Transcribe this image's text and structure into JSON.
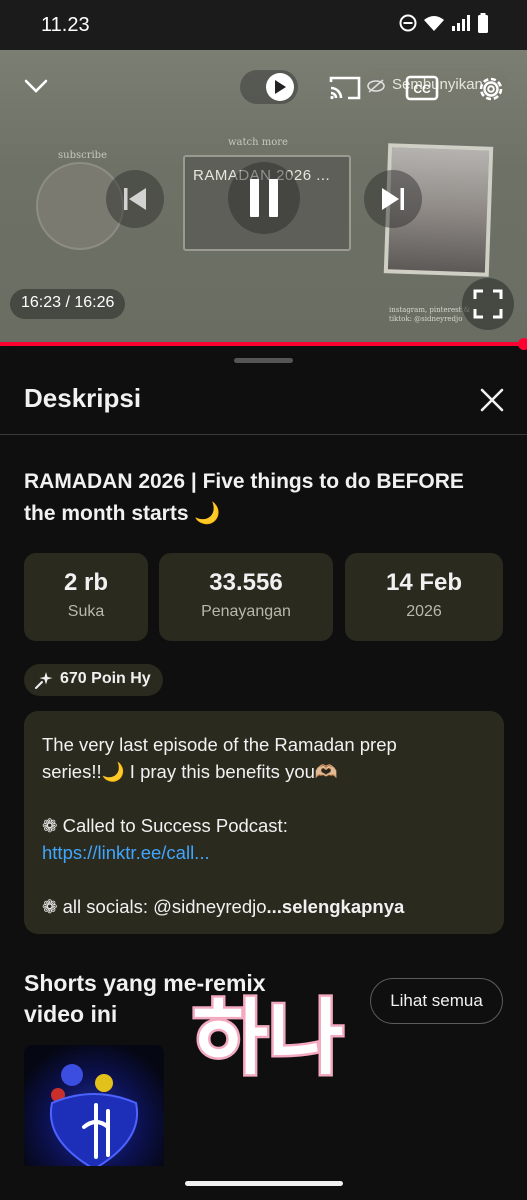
{
  "status_bar": {
    "time": "11.23"
  },
  "player": {
    "thumbnail": {
      "card_title": "RAMADAN 2026 ...",
      "subscribe_text": "subscribe",
      "watch_more_text": "watch more",
      "socials_caption": "instagram, pinterest & tiktok: @sidneyredjo"
    },
    "caption_overlay": "Sembunyikan",
    "time_display": "16:23 / 16:26",
    "progress_fraction": 0.995
  },
  "sheet": {
    "title": "Deskripsi",
    "video_title": "RAMADAN 2026 | Five things to do BEFORE the month starts 🌙",
    "stats": [
      {
        "value": "2 rb",
        "label": "Suka"
      },
      {
        "value": "33.556",
        "label": "Penayangan"
      },
      {
        "value": "14 Feb",
        "label": "2026"
      }
    ],
    "points_chip": "670 Poin Hy",
    "description": {
      "line1": "The very last episode of the Ramadan prep",
      "line2": "series!!🌙 I pray this benefits you🫶🏼",
      "line3": "❁ Called to Success Podcast:",
      "link": "https://linktr.ee/call...",
      "line5": "❁ all socials: @sidneyredjo",
      "more": "...selengkapnya"
    },
    "sticker_text": "하나",
    "shorts_section": {
      "title": "Shorts yang me-remix video ini",
      "see_all": "Lihat semua"
    }
  },
  "colors": {
    "accent_red": "#ff0033",
    "link_blue": "#3ea6ff",
    "card_bg": "#2b2a1f"
  }
}
